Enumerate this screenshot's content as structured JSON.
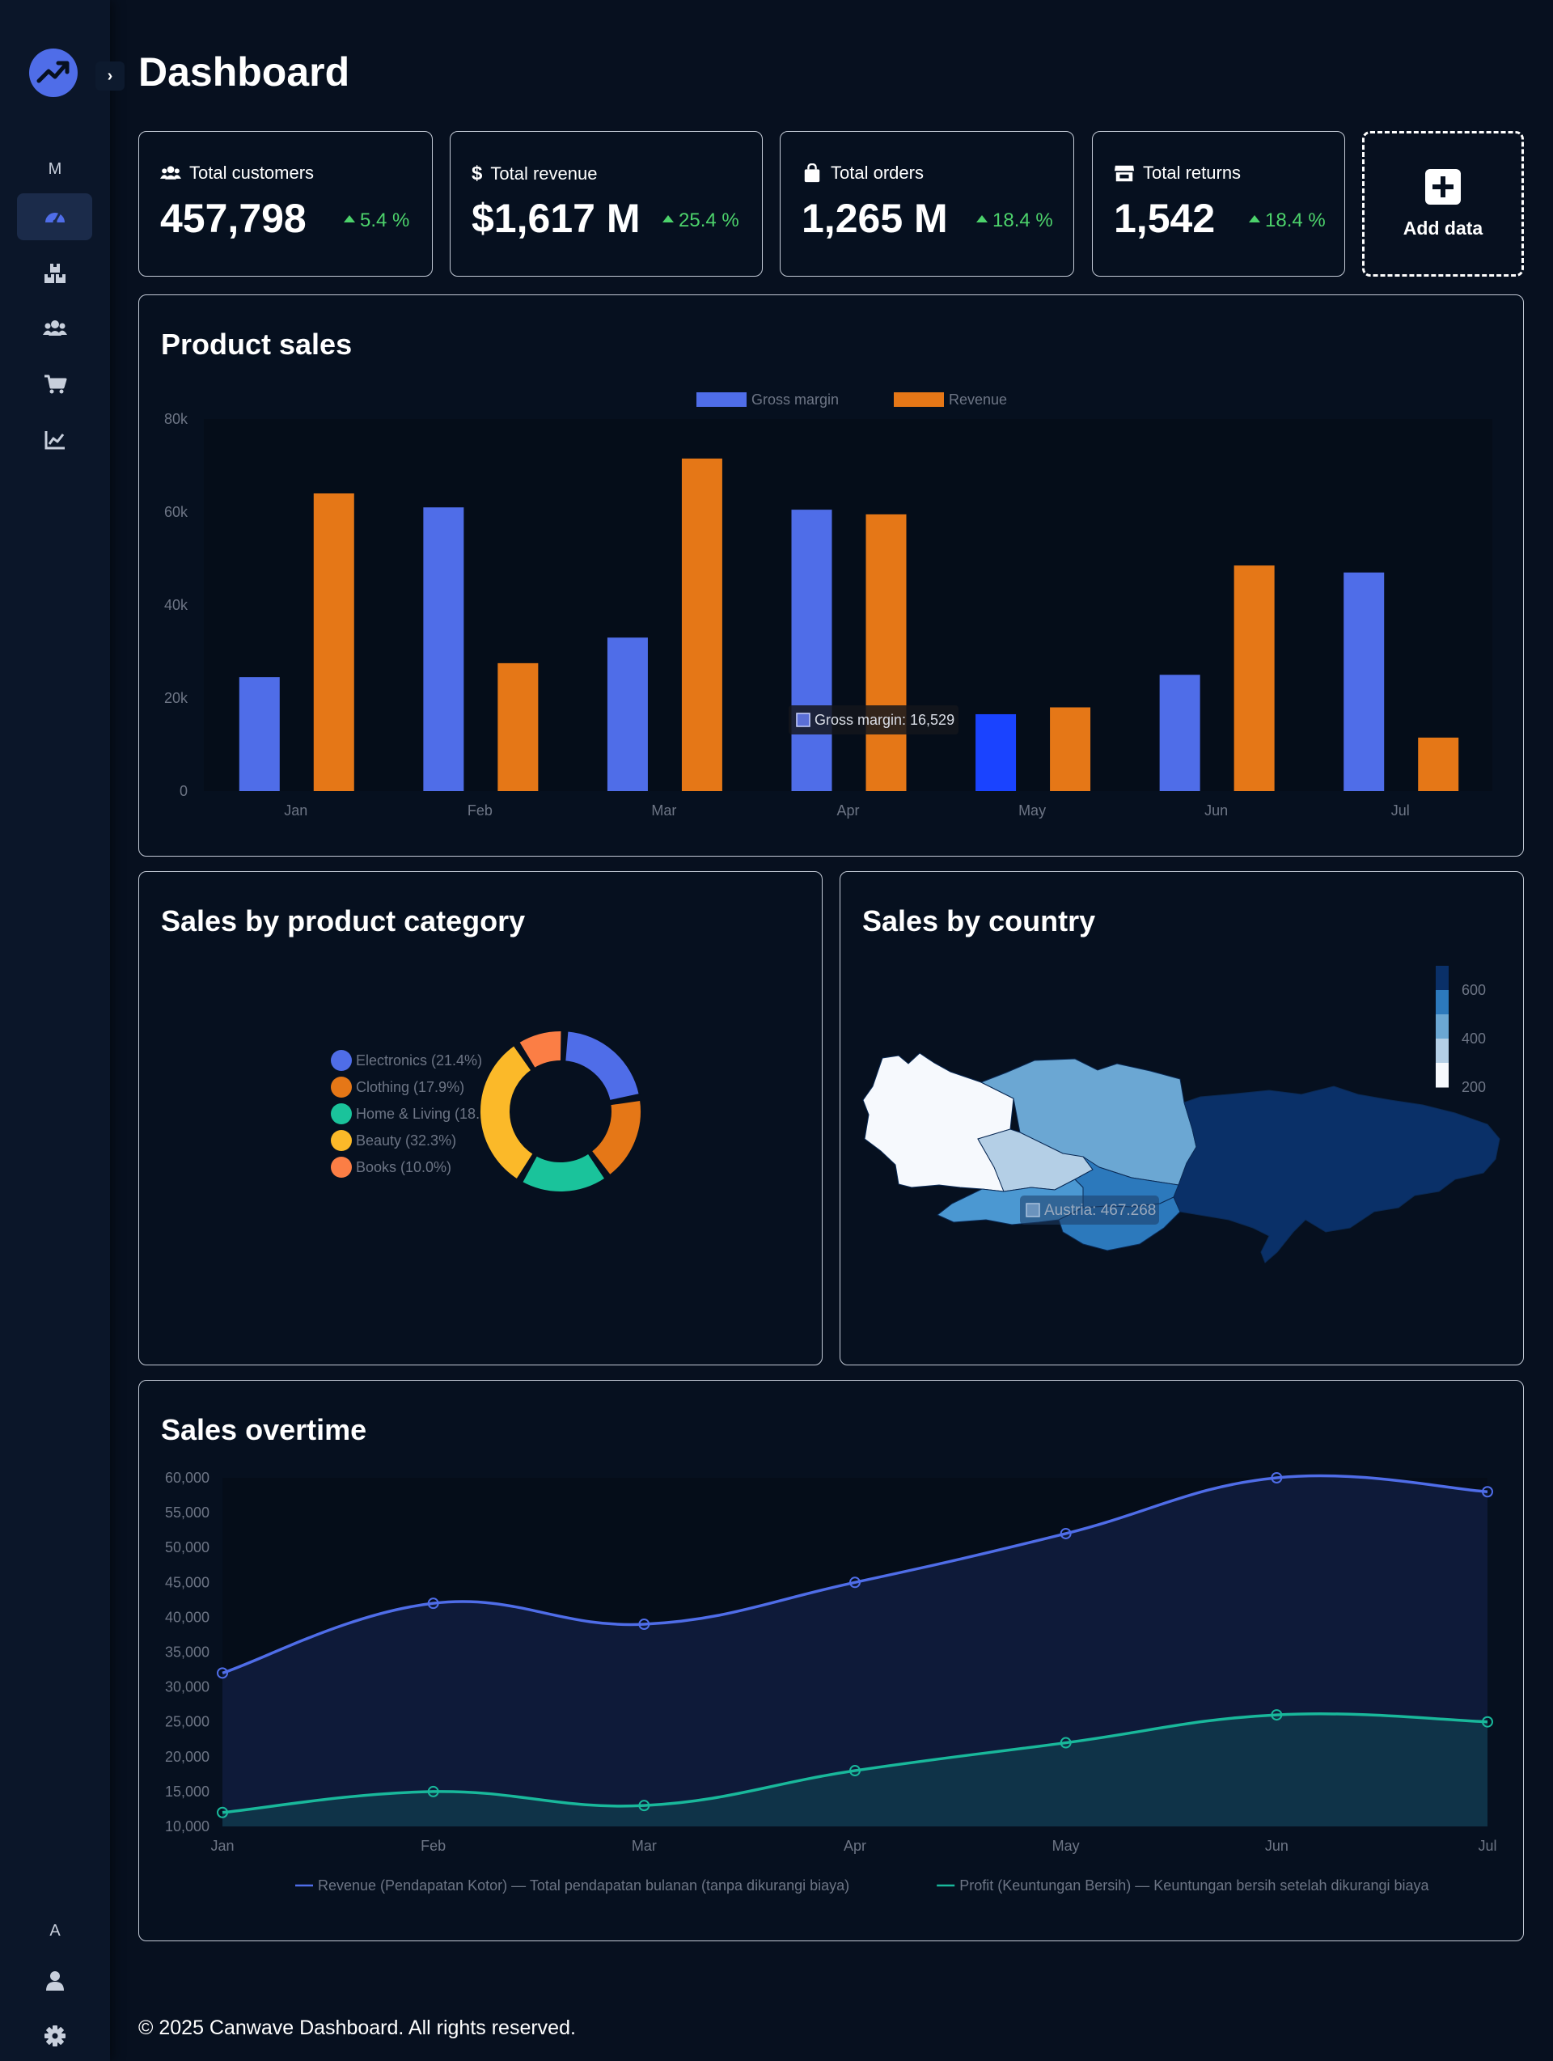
{
  "header": {
    "title": "Dashboard"
  },
  "sidebar": {
    "top_letter": "M",
    "bottom_letter": "A",
    "items": [
      {
        "icon": "gauge-icon",
        "active": true
      },
      {
        "icon": "boxes-icon",
        "active": false
      },
      {
        "icon": "users-icon",
        "active": false
      },
      {
        "icon": "cart-icon",
        "active": false
      },
      {
        "icon": "chart-line-icon",
        "active": false
      }
    ],
    "bottom_items": [
      {
        "icon": "user-icon"
      },
      {
        "icon": "gear-icon"
      }
    ]
  },
  "stats": [
    {
      "label": "Total customers",
      "value": "457,798",
      "change": "5.4 %",
      "icon": "users-icon"
    },
    {
      "label": "Total revenue",
      "value": "$1,617 M",
      "change": "25.4 %",
      "icon": "dollar-icon"
    },
    {
      "label": "Total orders",
      "value": "1,265 M",
      "change": "18.4 %",
      "icon": "bag-icon"
    },
    {
      "label": "Total returns",
      "value": "1,542",
      "change": "18.4 %",
      "icon": "store-icon"
    }
  ],
  "add_data": {
    "label": "Add data"
  },
  "product_sales": {
    "title": "Product sales",
    "tooltip": "Gross margin: 16,529"
  },
  "category": {
    "title": "Sales by product category"
  },
  "country": {
    "title": "Sales by country",
    "tooltip": "Austria: 467.268"
  },
  "overtime": {
    "title": "Sales overtime"
  },
  "footer": {
    "text": "© 2025 Canwave Dashboard. All rights reserved."
  },
  "colors": {
    "accent": "#4f6de8",
    "orange": "#e57717",
    "green": "#4cd26b",
    "teal": "#19b89b"
  },
  "chart_data": [
    {
      "type": "bar",
      "categories": [
        "Jan",
        "Feb",
        "Mar",
        "Apr",
        "May",
        "Jun",
        "Jul"
      ],
      "series": [
        {
          "name": "Gross margin",
          "color": "#4f6de8",
          "values": [
            24500,
            61000,
            33000,
            60500,
            16529,
            25000,
            47000
          ]
        },
        {
          "name": "Revenue",
          "color": "#e57717",
          "values": [
            64000,
            27500,
            71500,
            59500,
            18000,
            48500,
            11500
          ]
        }
      ],
      "yticks": [
        "0",
        "20k",
        "40k",
        "60k",
        "80k"
      ],
      "ylim": [
        0,
        80000
      ],
      "legend": "top-center",
      "highlight": {
        "series": "Gross margin",
        "category": "May"
      }
    },
    {
      "type": "pie",
      "donut": true,
      "categories": [
        "Electronics (21.4%)",
        "Clothing (17.9%)",
        "Home & Living (18.",
        "Beauty (32.3%)",
        "Books (10.0%)"
      ],
      "values": [
        21.4,
        17.9,
        18.4,
        32.3,
        10.0
      ],
      "colors": [
        "#4f6de8",
        "#e57717",
        "#1ac39b",
        "#fbb929",
        "#fb7e45"
      ],
      "legend": "left"
    },
    {
      "type": "heatmap",
      "map": "central-europe",
      "regions": [
        {
          "name": "Germany",
          "color": "#f6f9fd"
        },
        {
          "name": "Poland",
          "color": "#6ba7d3"
        },
        {
          "name": "Czechia",
          "color": "#b4cfe6"
        },
        {
          "name": "Austria",
          "color": "#4b98d2",
          "value": 467.268
        },
        {
          "name": "Slovakia",
          "color": "#2c79bc"
        },
        {
          "name": "Hungary",
          "color": "#2c79bc"
        },
        {
          "name": "Ukraine",
          "color": "#0a3068"
        }
      ],
      "scale_ticks": [
        "600",
        "400",
        "200"
      ],
      "scale_colors": [
        "#0a3068",
        "#2c79bc",
        "#6ba7d3",
        "#b4cfe6",
        "#f6f9fd"
      ]
    },
    {
      "type": "area",
      "x": [
        "Jan",
        "Feb",
        "Mar",
        "Apr",
        "May",
        "Jun",
        "Jul"
      ],
      "series": [
        {
          "name": "Revenue (Pendapatan Kotor) — Total pendapatan bulanan (tanpa dikurangi biaya)",
          "color": "#4f6de8",
          "values": [
            32000,
            42000,
            39000,
            45000,
            52000,
            60000,
            58000
          ]
        },
        {
          "name": "Profit (Keuntungan Bersih) — Keuntungan bersih setelah dikurangi biaya",
          "color": "#19b89b",
          "values": [
            12000,
            15000,
            13000,
            18000,
            22000,
            26000,
            25000
          ]
        }
      ],
      "yticks": [
        "10,000",
        "15,000",
        "20,000",
        "25,000",
        "30,000",
        "35,000",
        "40,000",
        "45,000",
        "50,000",
        "55,000",
        "60,000"
      ],
      "ylim": [
        10000,
        60000
      ],
      "legend": "bottom-center"
    }
  ]
}
